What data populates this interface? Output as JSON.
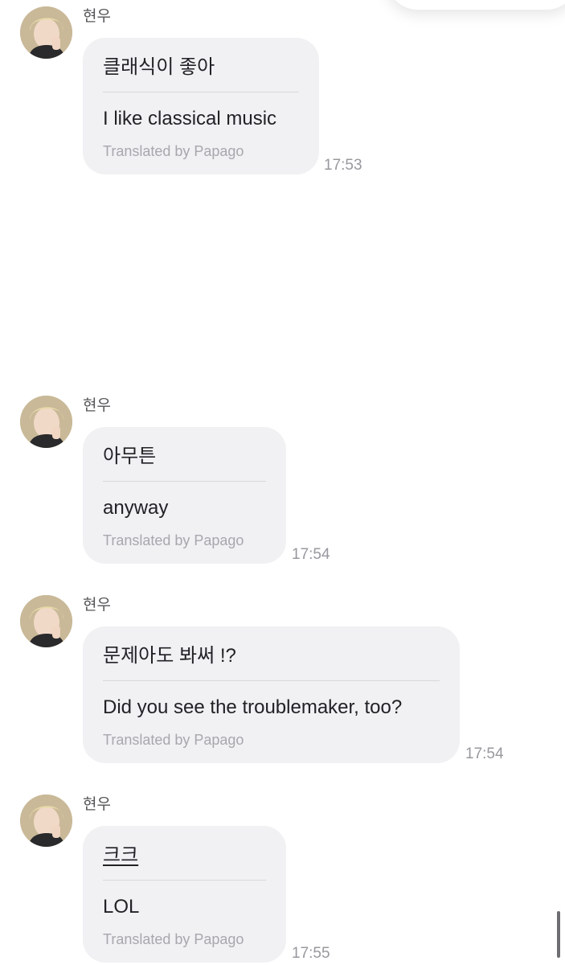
{
  "messages": [
    {
      "sender": "현우",
      "original": "클래식이 좋아",
      "translated": "I like classical music",
      "credit": "Translated by Papago",
      "time": "17:53"
    },
    {
      "sender": "현우",
      "original": "아무튼",
      "translated": "anyway",
      "credit": "Translated by Papago",
      "time": "17:54"
    },
    {
      "sender": "현우",
      "original": "문제아도 봐써 !?",
      "translated": "Did you see the troublemaker, too?",
      "credit": "Translated by Papago",
      "time": "17:54"
    },
    {
      "sender": "현우",
      "original": "크크",
      "translated": "LOL",
      "credit": "Translated by Papago",
      "time": "17:55"
    }
  ],
  "colors": {
    "bubble": "#f1f1f4",
    "text": "#222226",
    "credit": "#a7a7ad",
    "time": "#98989e"
  },
  "icons": {
    "avatar": "profile-photo"
  }
}
